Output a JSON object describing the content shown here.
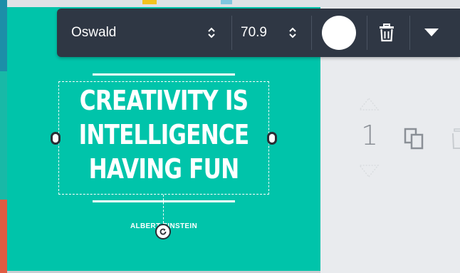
{
  "toolbar": {
    "font_name": "Oswald",
    "font_size": "70.9",
    "text_color": "#ffffff"
  },
  "design": {
    "background_color": "#00c4aa",
    "quote_lines": [
      "CREATIVITY IS",
      "INTELLIGENCE",
      "HAVING FUN"
    ],
    "author": "ALBERT EINSTEIN"
  },
  "page_panel": {
    "page_number": "1"
  },
  "icons": {
    "font_stepper": "chevron-up-down-icon",
    "size_stepper": "chevron-up-down-icon",
    "trash": "trash-icon",
    "more": "chevron-down-icon",
    "rotate": "rotate-icon",
    "duplicate": "duplicate-page-icon",
    "delete_page": "delete-page-icon",
    "move_up": "move-page-up-icon",
    "move_down": "move-page-down-icon"
  }
}
